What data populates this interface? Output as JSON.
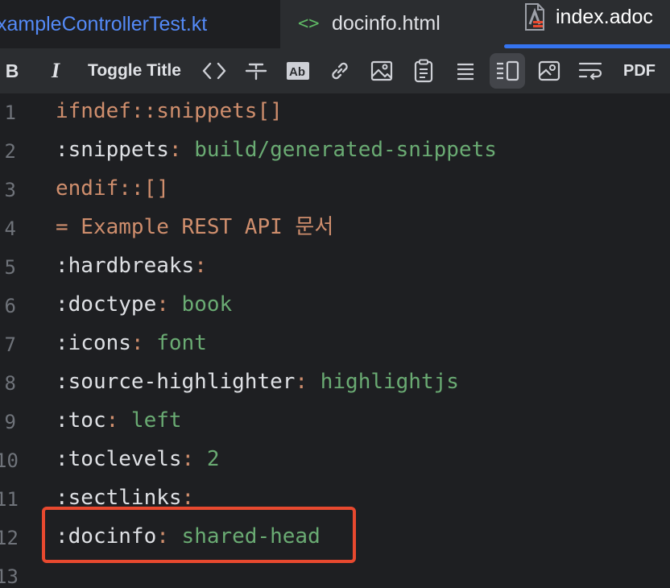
{
  "tabs": [
    {
      "label": "xampleControllerTest.kt",
      "icon": "kotlin-file-icon",
      "color": "#548af7"
    },
    {
      "label": "docinfo.html",
      "icon": "html-file-icon",
      "color": "#dfe1e5"
    },
    {
      "label": "index.adoc",
      "icon": "asciidoc-file-icon",
      "color": "#ffffff",
      "active": true
    }
  ],
  "toolbar": {
    "bold_label": "B",
    "italic_label": "I",
    "toggle_title_label": "Toggle Title",
    "pdf_label": "PDF",
    "icons": [
      "bold-icon",
      "italic-icon",
      "code-icon",
      "strikethrough-icon",
      "highlight-icon",
      "link-icon",
      "image-icon",
      "clipboard-icon",
      "list-icon",
      "editor-preview-icon",
      "image-settings-icon",
      "soft-wrap-icon"
    ]
  },
  "editor": {
    "line_numbers": [
      "1",
      "2",
      "3",
      "4",
      "5",
      "6",
      "7",
      "8",
      "9",
      "10",
      "11",
      "12",
      "13"
    ],
    "lines": [
      {
        "keyword": "ifndef::snippets[]"
      },
      {
        "attr": ":snippets",
        "colon": ":",
        "value": " build/generated-snippets"
      },
      {
        "keyword": "endif::[]"
      },
      {
        "keyword": "= Example REST API 문서"
      },
      {
        "attr": ":hardbreaks",
        "colon": ":"
      },
      {
        "attr": ":doctype",
        "colon": ":",
        "value": " book"
      },
      {
        "attr": ":icons",
        "colon": ":",
        "value": " font"
      },
      {
        "attr": ":source-highlighter",
        "colon": ":",
        "value": " highlightjs"
      },
      {
        "attr": ":toc",
        "colon": ":",
        "value": " left"
      },
      {
        "attr": ":toclevels",
        "colon": ":",
        "value": " 2"
      },
      {
        "attr": ":sectlinks",
        "colon": ":"
      },
      {
        "attr": ":docinfo",
        "colon": ":",
        "value": " shared-head"
      },
      {}
    ]
  },
  "colors": {
    "background": "#1e1f22",
    "panel": "#2b2d30",
    "keyword": "#cf8e6d",
    "value": "#6aab73",
    "highlight_border": "#e8492f",
    "accent": "#3574f0"
  }
}
